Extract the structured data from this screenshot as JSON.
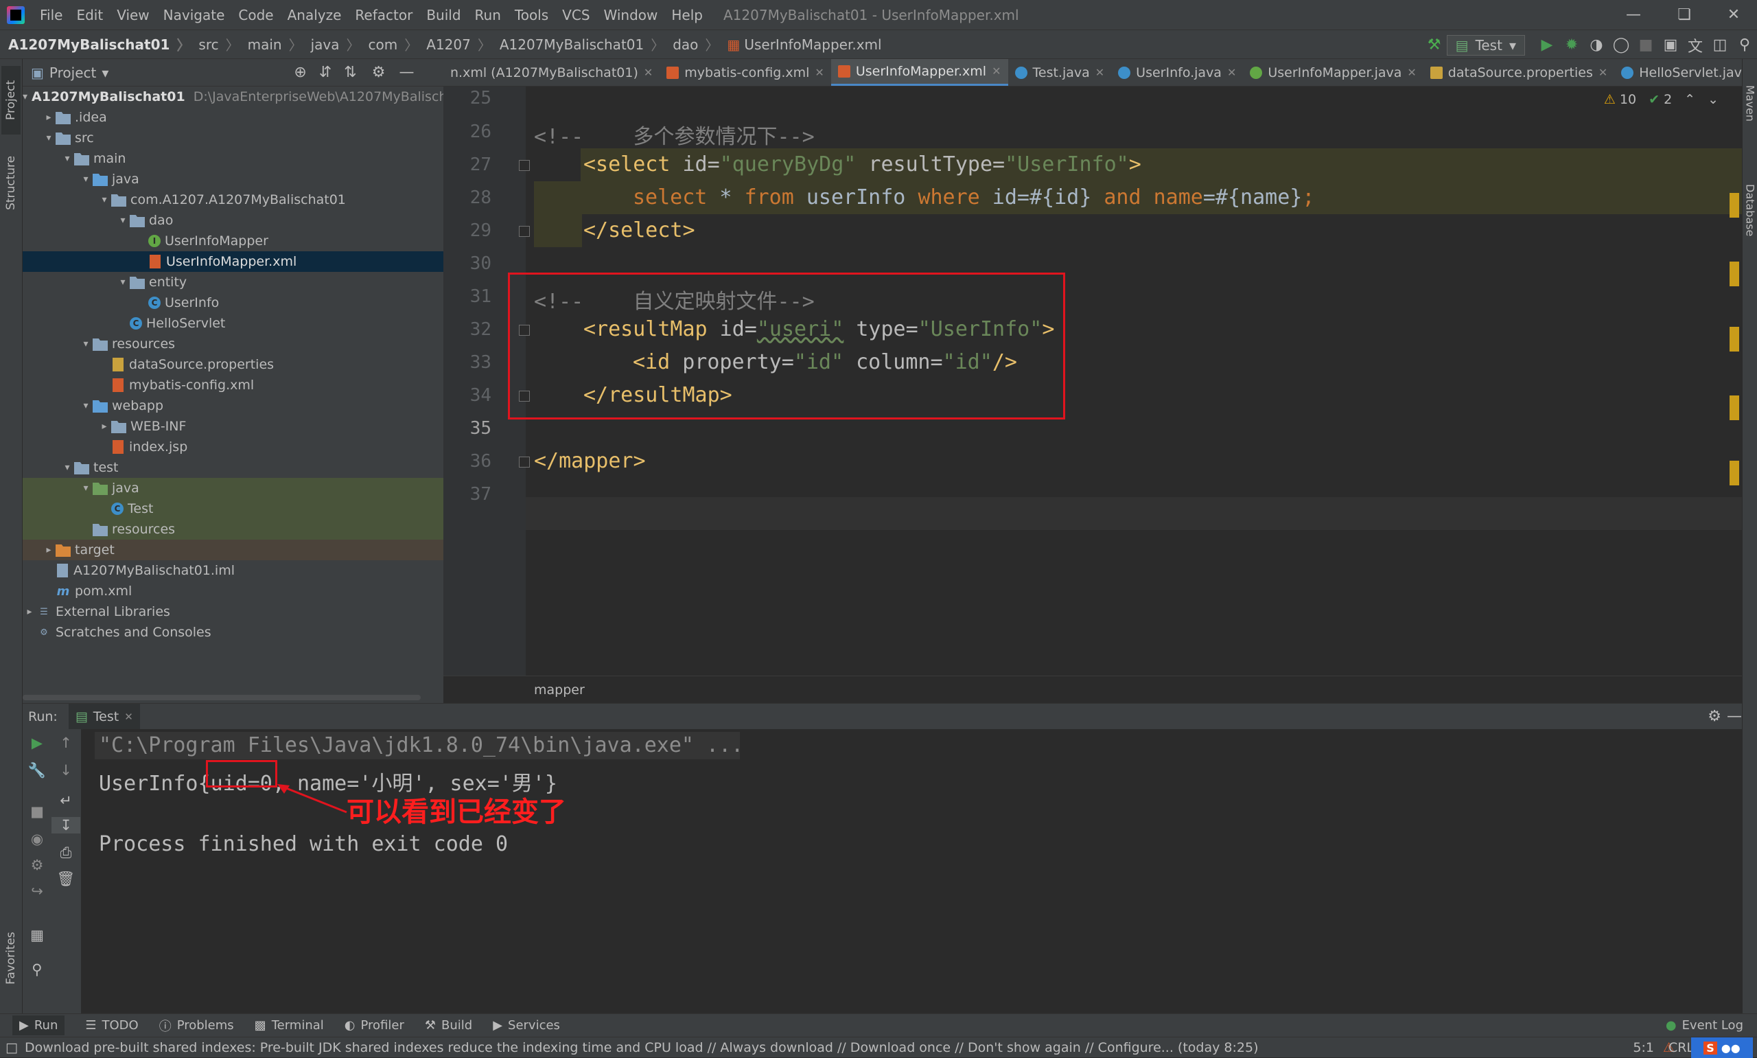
{
  "window": {
    "title": "A1207MyBalischat01 - UserInfoMapper.xml"
  },
  "menu": [
    "File",
    "Edit",
    "View",
    "Navigate",
    "Code",
    "Analyze",
    "Refactor",
    "Build",
    "Run",
    "Tools",
    "VCS",
    "Window",
    "Help"
  ],
  "breadcrumb": [
    "A1207MyBalischat01",
    "src",
    "main",
    "java",
    "com",
    "A1207",
    "A1207MyBalischat01",
    "dao",
    "UserInfoMapper.xml"
  ],
  "run_config": "Test",
  "left_tabs": {
    "project": "Project",
    "structure": "Structure",
    "favorites": "Favorites"
  },
  "right_tabs": {
    "maven": "Maven",
    "database": "Database"
  },
  "project": {
    "header": "Project",
    "root_name": "A1207MyBalischat01",
    "root_path": "D:\\JavaEnterpriseWeb\\A1207MyBalischa",
    "items": [
      {
        "label": ".idea"
      },
      {
        "label": "src"
      },
      {
        "label": "main"
      },
      {
        "label": "java"
      },
      {
        "label": "com.A1207.A1207MyBalischat01"
      },
      {
        "label": "dao"
      },
      {
        "label": "UserInfoMapper"
      },
      {
        "label": "UserInfoMapper.xml"
      },
      {
        "label": "entity"
      },
      {
        "label": "UserInfo"
      },
      {
        "label": "HelloServlet"
      },
      {
        "label": "resources"
      },
      {
        "label": "dataSource.properties"
      },
      {
        "label": "mybatis-config.xml"
      },
      {
        "label": "webapp"
      },
      {
        "label": "WEB-INF"
      },
      {
        "label": "index.jsp"
      },
      {
        "label": "test"
      },
      {
        "label": "java"
      },
      {
        "label": "Test"
      },
      {
        "label": "resources"
      },
      {
        "label": "target"
      },
      {
        "label": "A1207MyBalischat01.iml"
      },
      {
        "label": "pom.xml"
      },
      {
        "label": "External Libraries"
      },
      {
        "label": "Scratches and Consoles"
      }
    ]
  },
  "tabs": [
    {
      "label": "n.xml (A1207MyBalischat01)",
      "color": "#888888"
    },
    {
      "label": "mybatis-config.xml",
      "color": "#d35b2e"
    },
    {
      "label": "UserInfoMapper.xml",
      "color": "#d35b2e"
    },
    {
      "label": "Test.java",
      "color": "#3d8fc9"
    },
    {
      "label": "UserInfo.java",
      "color": "#3d8fc9"
    },
    {
      "label": "UserInfoMapper.java",
      "color": "#62a745"
    },
    {
      "label": "dataSource.properties",
      "color": "#c9a23d"
    },
    {
      "label": "HelloServlet.java",
      "color": "#3d8fc9"
    }
  ],
  "editor": {
    "warnings": "10",
    "ok": "2",
    "line_numbers": [
      "25",
      "26",
      "27",
      "28",
      "29",
      "30",
      "31",
      "32",
      "33",
      "34",
      "35",
      "36",
      "37"
    ],
    "comment1": "<!--    多个参数情况下-->",
    "line27": {
      "open": "<select",
      "id_attr": " id=",
      "id_val": "\"queryByDg\"",
      "rt_attr": " resultType=",
      "rt_val": "\"UserInfo\"",
      "close": ">"
    },
    "line28": {
      "kw1": "select",
      "star": " * ",
      "kw2": "from",
      "t1": " userInfo ",
      "kw3": "where",
      "t2": " id=#{id} ",
      "kw4": "and",
      "t3": " name",
      "t4": "=#{name}",
      "semi": ";"
    },
    "line29": "</select>",
    "comment2": "<!--    自义定映射文件-->",
    "line32": {
      "open": "<resultMap",
      "id_attr": " id=",
      "id_val": "\"useri\"",
      "type_attr": " type=",
      "type_val": "\"UserInfo\"",
      "close": ">"
    },
    "line33": {
      "open": "<id",
      "p_attr": " property=",
      "p_val": "\"id\"",
      "c_attr": " column=",
      "c_val": "\"id\"",
      "close": "/>"
    },
    "line34": "</resultMap>",
    "line36": "</mapper>",
    "footer_crumb": "mapper"
  },
  "run": {
    "label": "Run:",
    "tab": "Test",
    "cmd": "\"C:\\Program Files\\Java\\jdk1.8.0_74\\bin\\java.exe\" ...",
    "out_pre": "UserInfo{",
    "out_uid": "uid=0",
    "out_post": ", name='小明', sex='男'}",
    "annotation": "可以看到已经变了",
    "finish": "Process finished with exit code 0"
  },
  "bottom_tabs": [
    "Run",
    "TODO",
    "Problems",
    "Terminal",
    "Profiler",
    "Build",
    "Services"
  ],
  "event_log": "Event Log",
  "status": {
    "message": "Download pre-built shared indexes: Pre-built JDK shared indexes reduce the indexing time and CPU load // Always download // Download once // Don't show again // Configure... (today 8:25)",
    "position": "5:1",
    "encoding": "CRL"
  },
  "colors": {
    "accent": "#4a88c7",
    "annotation_red": "#e0141e",
    "highlight": "#3b3b28"
  }
}
